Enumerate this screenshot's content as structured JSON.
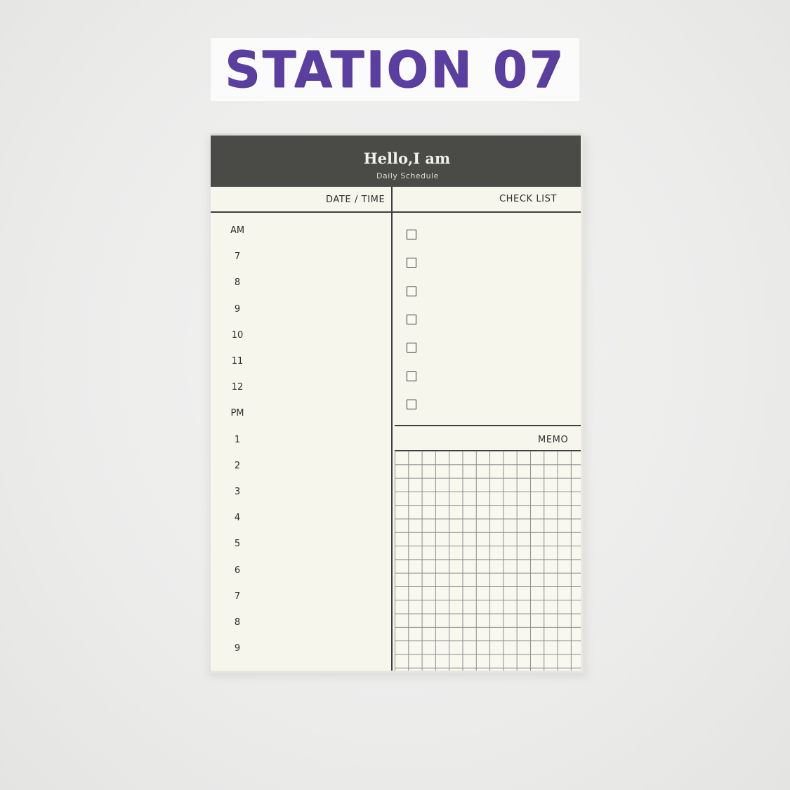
{
  "brand": {
    "text": "STATION 07",
    "color": "#5b3fa0"
  },
  "notepad": {
    "title": "Hello,I am",
    "subtitle": "Daily  Schedule",
    "header_color": "#4a4a47",
    "paper_color": "#f6f6ec",
    "date_time_label": "DATE / TIME",
    "checklist_label": "CHECK LIST",
    "memo_label": "MEMO",
    "hours": [
      "AM",
      "7",
      "8",
      "9",
      "10",
      "11",
      "12",
      "PM",
      "1",
      "2",
      "3",
      "4",
      "5",
      "6",
      "7",
      "8",
      "9"
    ],
    "checklist_box_count": 7
  }
}
